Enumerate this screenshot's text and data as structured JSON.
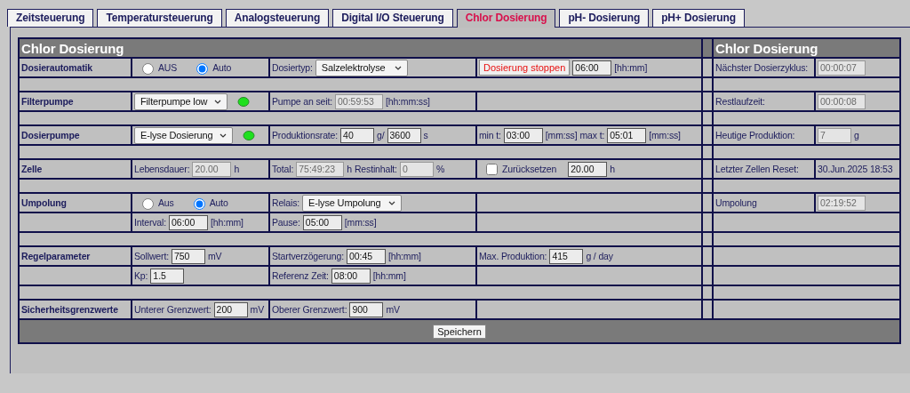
{
  "tabs": [
    {
      "label": "Zeitsteuerung",
      "selected": false
    },
    {
      "label": "Temperatursteuerung",
      "selected": false
    },
    {
      "label": "Analogsteuerung",
      "selected": false
    },
    {
      "label": "Digital I/O Steuerung",
      "selected": false
    },
    {
      "label": "Chlor Dosierung",
      "selected": true
    },
    {
      "label": "pH- Dosierung",
      "selected": false
    },
    {
      "label": "pH+ Dosierung",
      "selected": false
    }
  ],
  "panel": {
    "title": "Chlor Dosierung",
    "side_title": "Chlor Dosierung",
    "rows": [
      {
        "kind": "row",
        "label": "Dosierautomatik",
        "cells": [
          [
            {
              "kind": "radio",
              "label": "AUS",
              "selected": false
            },
            {
              "kind": "radio",
              "label": "Auto",
              "selected": true
            }
          ],
          [
            {
              "kind": "text",
              "text": "Dosiertyp:"
            },
            {
              "kind": "select",
              "value": "Salzelektrolyse"
            }
          ],
          [
            {
              "kind": "button",
              "label": "Dosierung stoppen"
            },
            {
              "kind": "input",
              "value": "06:00",
              "disabled": false
            },
            {
              "kind": "text",
              "text": "[hh:mm]"
            }
          ]
        ],
        "side": [
          [
            {
              "kind": "text",
              "text": "Nächster Dosierzyklus:"
            }
          ],
          [
            {
              "kind": "input",
              "value": "00:00:07",
              "disabled": true
            }
          ]
        ]
      },
      {
        "kind": "spacer"
      },
      {
        "kind": "row",
        "label": "Filterpumpe",
        "cells": [
          [
            {
              "kind": "select",
              "value": "Filterpumpe low"
            },
            {
              "kind": "led",
              "on": true
            }
          ],
          [
            {
              "kind": "text",
              "text": "Pumpe an seit:"
            },
            {
              "kind": "input",
              "value": "00:59:53",
              "disabled": true
            },
            {
              "kind": "text",
              "text": "[hh:mm:ss]"
            }
          ],
          []
        ],
        "side": [
          [
            {
              "kind": "text",
              "text": "Restlaufzeit:"
            }
          ],
          [
            {
              "kind": "input",
              "value": "00:00:08",
              "disabled": true
            }
          ]
        ]
      },
      {
        "kind": "spacer"
      },
      {
        "kind": "row",
        "label": "Dosierpumpe",
        "cells": [
          [
            {
              "kind": "select",
              "value": "E-lyse Dosierung"
            },
            {
              "kind": "led",
              "on": true
            }
          ],
          [
            {
              "kind": "text",
              "text": "Produktionsrate:"
            },
            {
              "kind": "input",
              "value": "40",
              "disabled": false
            },
            {
              "kind": "text",
              "text": "g/"
            },
            {
              "kind": "input",
              "value": "3600",
              "disabled": false
            },
            {
              "kind": "text",
              "text": "s"
            }
          ],
          [
            {
              "kind": "text",
              "text": "min t:"
            },
            {
              "kind": "input",
              "value": "03:00",
              "disabled": false
            },
            {
              "kind": "text",
              "text": "[mm:ss]"
            },
            {
              "kind": "text",
              "text": "max t:"
            },
            {
              "kind": "input",
              "value": "05:01",
              "disabled": false
            },
            {
              "kind": "text",
              "text": "[mm:ss]"
            }
          ]
        ],
        "side": [
          [
            {
              "kind": "text",
              "text": "Heutige Produktion:"
            }
          ],
          [
            {
              "kind": "input",
              "value": "7",
              "disabled": true
            },
            {
              "kind": "text",
              "text": "g"
            }
          ]
        ]
      },
      {
        "kind": "spacer"
      },
      {
        "kind": "row",
        "label": "Zelle",
        "cells": [
          [
            {
              "kind": "text",
              "text": "Lebensdauer:"
            },
            {
              "kind": "input",
              "value": "20.00",
              "disabled": true
            },
            {
              "kind": "text",
              "text": "h"
            }
          ],
          [
            {
              "kind": "text",
              "text": "Total:"
            },
            {
              "kind": "input",
              "value": "75:49:23",
              "disabled": true
            },
            {
              "kind": "text",
              "text": "h"
            },
            {
              "kind": "text",
              "text": "Restinhalt:"
            },
            {
              "kind": "input",
              "value": "0",
              "disabled": true
            },
            {
              "kind": "text",
              "text": "%"
            }
          ],
          [
            {
              "kind": "checkbox",
              "label": "Zurücksetzen",
              "checked": false
            },
            {
              "kind": "input",
              "value": "20.00",
              "disabled": false
            },
            {
              "kind": "text",
              "text": "h"
            }
          ]
        ],
        "side": [
          [
            {
              "kind": "text",
              "text": "Letzter Zellen Reset:"
            }
          ],
          [
            {
              "kind": "value",
              "text": "30.Jun.2025 18:53"
            }
          ]
        ]
      },
      {
        "kind": "spacer"
      },
      {
        "kind": "row",
        "label": "Umpolung",
        "cells": [
          [
            {
              "kind": "radio",
              "label": "Aus",
              "selected": false
            },
            {
              "kind": "radio",
              "label": "Auto",
              "selected": true
            }
          ],
          [
            {
              "kind": "text",
              "text": "Relais:"
            },
            {
              "kind": "select",
              "value": "E-lyse Umpolung"
            }
          ],
          []
        ],
        "side": [
          [
            {
              "kind": "text",
              "text": "Umpolung"
            }
          ],
          [
            {
              "kind": "input",
              "value": "02:19:52",
              "disabled": true
            }
          ]
        ]
      },
      {
        "kind": "row",
        "cells": [
          [
            {
              "kind": "text",
              "text": "Interval:"
            },
            {
              "kind": "input",
              "value": "06:00",
              "disabled": false
            },
            {
              "kind": "text",
              "text": "[hh:mm]"
            }
          ],
          [
            {
              "kind": "text",
              "text": "Pause:"
            },
            {
              "kind": "input",
              "value": "05:00",
              "disabled": false
            },
            {
              "kind": "text",
              "text": "[mm:ss]"
            }
          ],
          []
        ]
      },
      {
        "kind": "spacer"
      },
      {
        "kind": "row",
        "label": "Regelparameter",
        "cells": [
          [
            {
              "kind": "text",
              "text": "Sollwert:"
            },
            {
              "kind": "input",
              "value": "750",
              "disabled": false
            },
            {
              "kind": "text",
              "text": "mV"
            }
          ],
          [
            {
              "kind": "text",
              "text": "Startverzögerung:"
            },
            {
              "kind": "input",
              "value": "00:45",
              "disabled": false
            },
            {
              "kind": "text",
              "text": "[hh:mm]"
            }
          ],
          [
            {
              "kind": "text",
              "text": "Max. Produktion:"
            },
            {
              "kind": "input",
              "value": "415",
              "disabled": false
            },
            {
              "kind": "text",
              "text": "g / day"
            }
          ]
        ]
      },
      {
        "kind": "row",
        "cells": [
          [
            {
              "kind": "text",
              "text": "Kp:"
            },
            {
              "kind": "input",
              "value": "1.5",
              "disabled": false
            }
          ],
          [
            {
              "kind": "text",
              "text": "Referenz Zeit:"
            },
            {
              "kind": "input",
              "value": "08:00",
              "disabled": false
            },
            {
              "kind": "text",
              "text": "[hh:mm]"
            }
          ],
          []
        ]
      },
      {
        "kind": "spacer"
      },
      {
        "kind": "row",
        "label": "Sicherheitsgrenzwerte",
        "cells": [
          [
            {
              "kind": "text",
              "text": "Unterer Grenzwert:"
            },
            {
              "kind": "input",
              "value": "200",
              "disabled": false
            },
            {
              "kind": "text",
              "text": "mV"
            }
          ],
          [
            {
              "kind": "text",
              "text": "Oberer Grenzwert:"
            },
            {
              "kind": "input",
              "value": "900",
              "disabled": false
            },
            {
              "kind": "text",
              "text": "mV"
            }
          ],
          []
        ]
      }
    ],
    "save_button": "Speichern"
  }
}
